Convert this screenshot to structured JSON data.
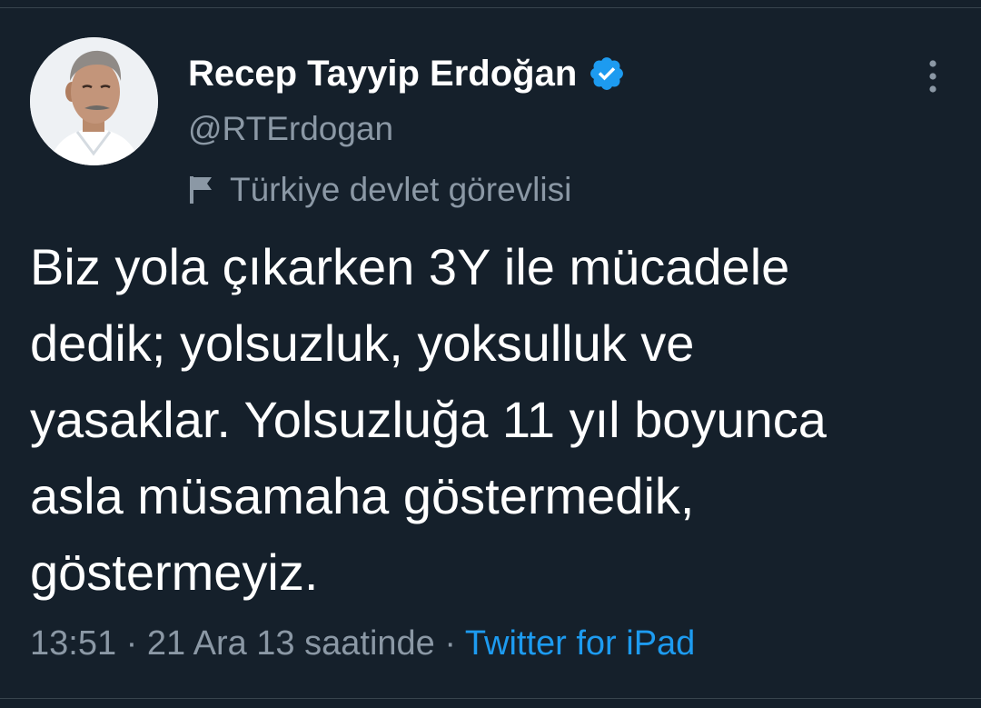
{
  "author": {
    "display_name": "Recep Tayyip Erdoğan",
    "handle": "@RTErdogan",
    "verified": true,
    "label": "Türkiye devlet görevlisi",
    "label_icon": "flag-icon",
    "avatar_icon": "avatar"
  },
  "tweet": {
    "text": "Biz yola çıkarken 3Y ile mücadele\ndedik; yolsuzluk, yoksulluk ve\nyasaklar. Yolsuzluğa 11 yıl boyunca\nasla müsamaha göstermedik,\ngöstermeyiz.",
    "time": "13:51",
    "separator": "·",
    "date": "21 Ara 13 saatinde",
    "source": "Twitter for iPad"
  },
  "icons": {
    "more": "more-vertical-icon",
    "verified": "verified-badge-icon"
  },
  "colors": {
    "background": "#15202b",
    "primary_text": "#ffffff",
    "secondary_text": "#8b98a5",
    "accent": "#1d9bf0",
    "divider": "#38444d"
  }
}
